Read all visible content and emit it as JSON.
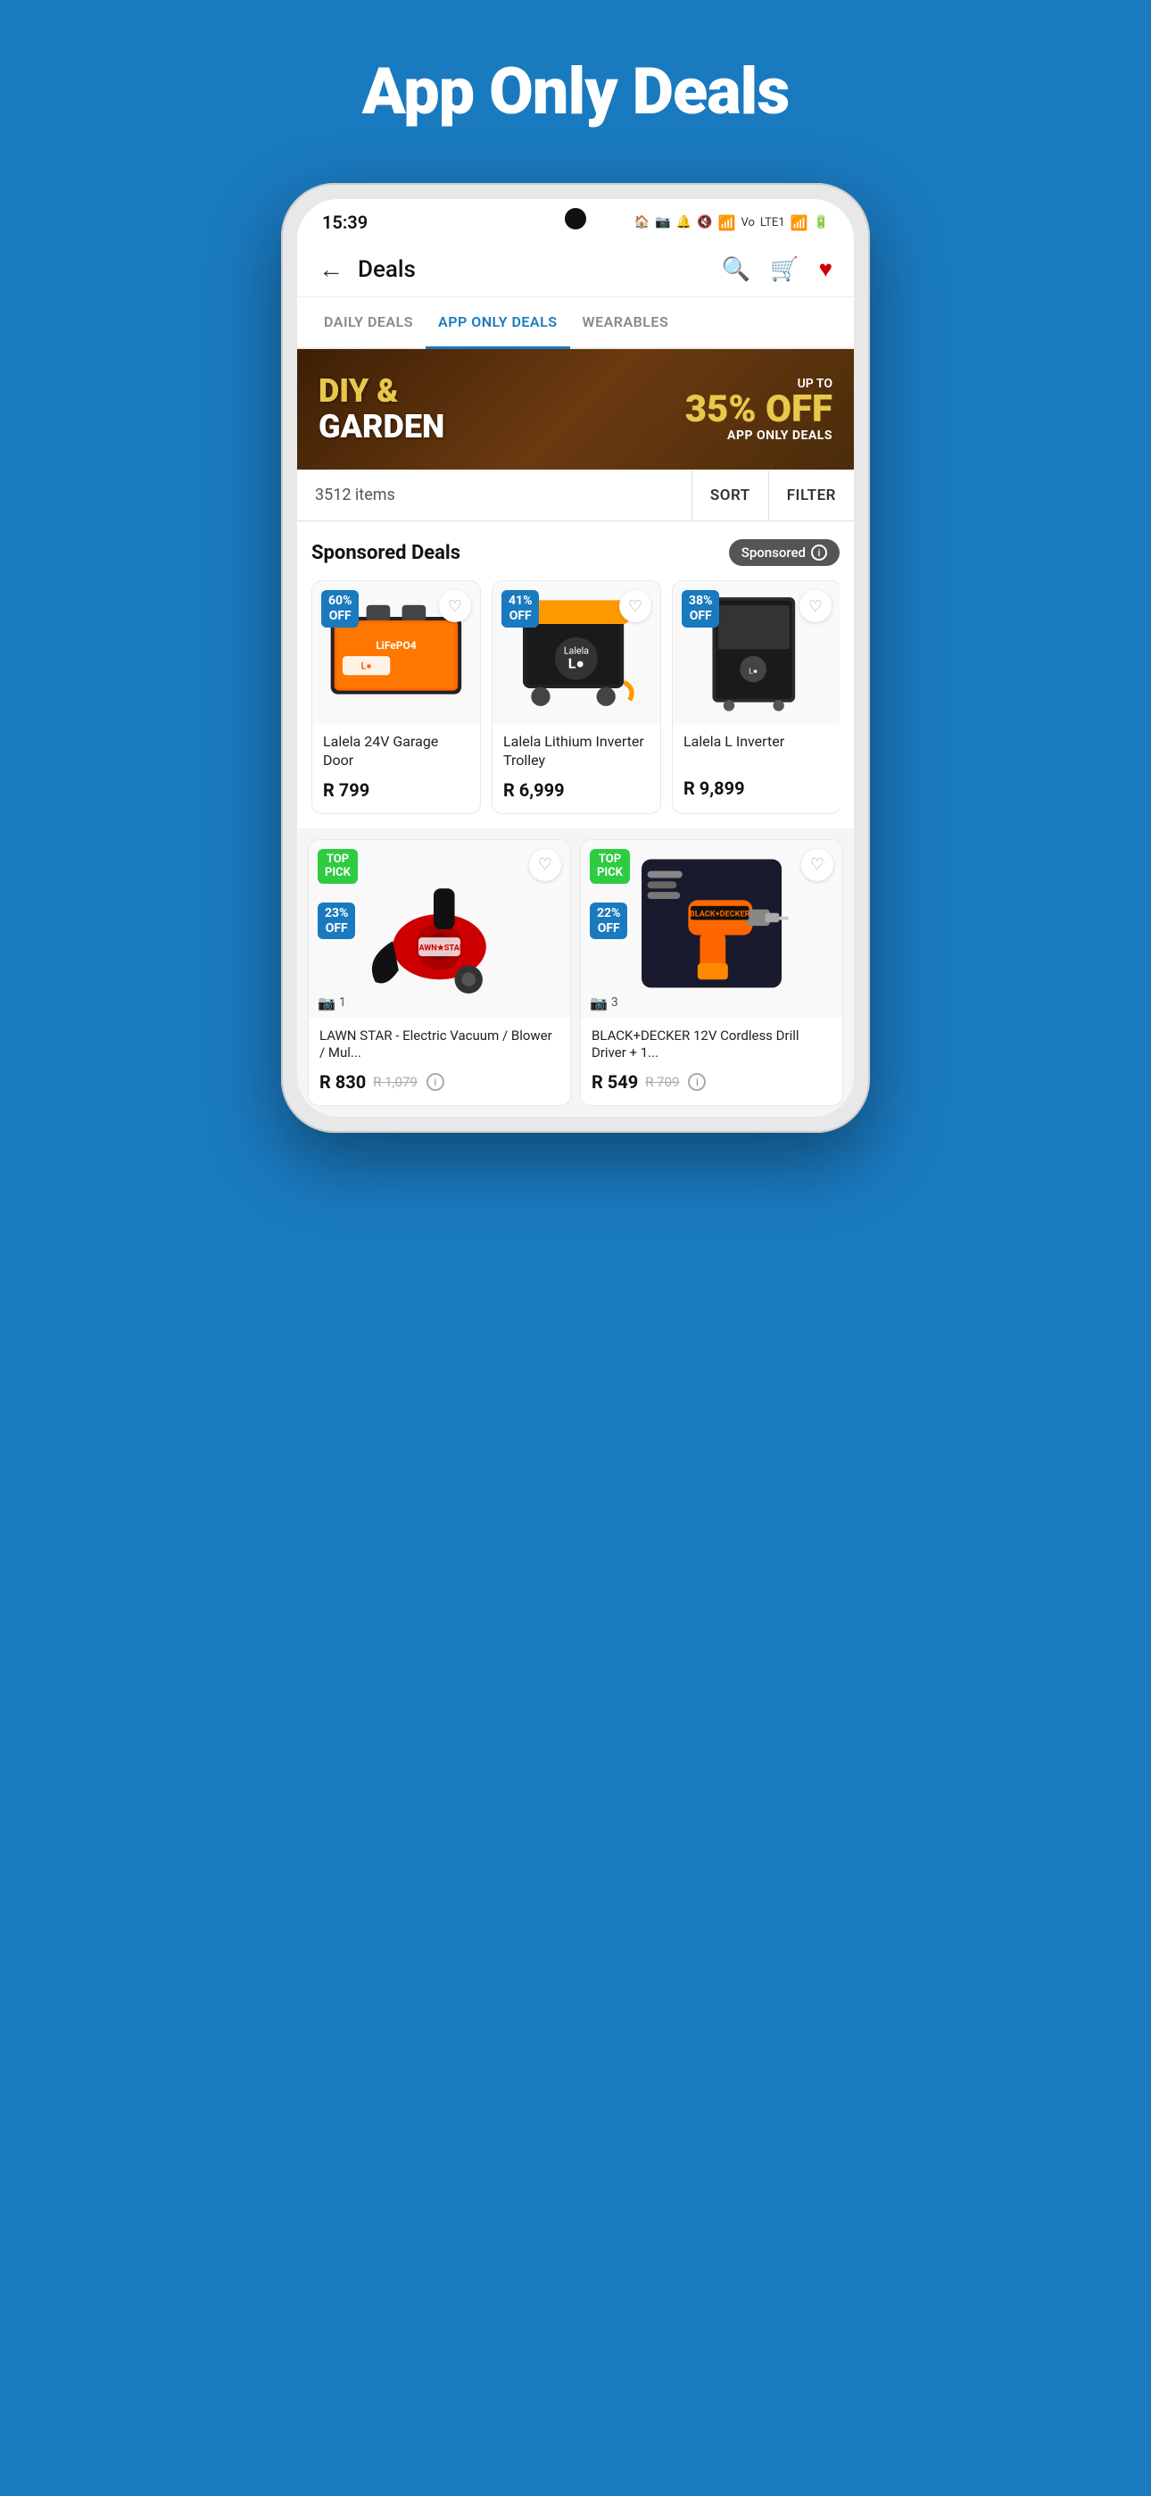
{
  "page": {
    "title": "App Only Deals",
    "background_color": "#1a7abf"
  },
  "status_bar": {
    "time": "15:39",
    "icons": "🏠 📷 🔔 🔇 📶 Vo LTE1 📶 🔋"
  },
  "nav": {
    "back_label": "←",
    "title": "Deals",
    "search_icon": "search",
    "cart_icon": "cart",
    "wishlist_icon": "heart"
  },
  "tabs": [
    {
      "label": "DAILY DEALS",
      "active": false
    },
    {
      "label": "APP ONLY DEALS",
      "active": true
    },
    {
      "label": "WEARABLES",
      "active": false
    }
  ],
  "banner": {
    "diy_text": "DIY &",
    "garden_text": "GARDEN",
    "upto_text": "UP TO",
    "percent_text": "35% OFF",
    "app_only_text": "APP ONLY DEALS"
  },
  "items_bar": {
    "count": "3512 items",
    "sort_label": "SORT",
    "filter_label": "FILTER"
  },
  "sponsored_section": {
    "title": "Sponsored Deals",
    "badge_label": "Sponsored",
    "products": [
      {
        "discount": "60%",
        "discount_line2": "OFF",
        "name": "Lalela 24V Garage Door",
        "price": "R 799",
        "color": "#ff6b00"
      },
      {
        "discount": "41%",
        "discount_line2": "OFF",
        "name": "Lalela Lithium Inverter Trolley",
        "price": "R 6,999",
        "color": "#ff9900"
      },
      {
        "discount": "38%",
        "discount_line2": "OFF",
        "name": "Lalela L Inverter",
        "price": "R 9,899",
        "color": "#333"
      }
    ]
  },
  "grid_products": [
    {
      "top_pick": true,
      "discount": "23%",
      "discount_line2": "OFF",
      "photo_count": "1",
      "name": "LAWN STAR - Electric Vacuum / Blower / Mul...",
      "price": "R 830",
      "orig_price": "R 1,079"
    },
    {
      "top_pick": true,
      "discount": "22%",
      "discount_line2": "OFF",
      "photo_count": "3",
      "name": "BLACK+DECKER 12V Cordless Drill Driver + 1...",
      "price": "R 549",
      "orig_price": "R 709"
    }
  ]
}
